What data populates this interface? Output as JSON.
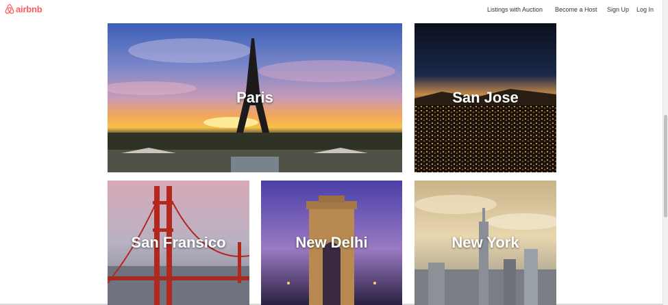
{
  "header": {
    "logo_text": "airbnb",
    "logo_icon": "airbnb-belo-icon",
    "brand_color": "#FF5A5F",
    "nav": {
      "listings": "Listings with Auction",
      "host": "Become a Host",
      "signup": "Sign Up",
      "login": "Log In"
    }
  },
  "cities": {
    "paris": "Paris",
    "san_jose": "San Jose",
    "san_francisco": "San Fransico",
    "new_delhi": "New Delhi",
    "new_york": "New York"
  }
}
